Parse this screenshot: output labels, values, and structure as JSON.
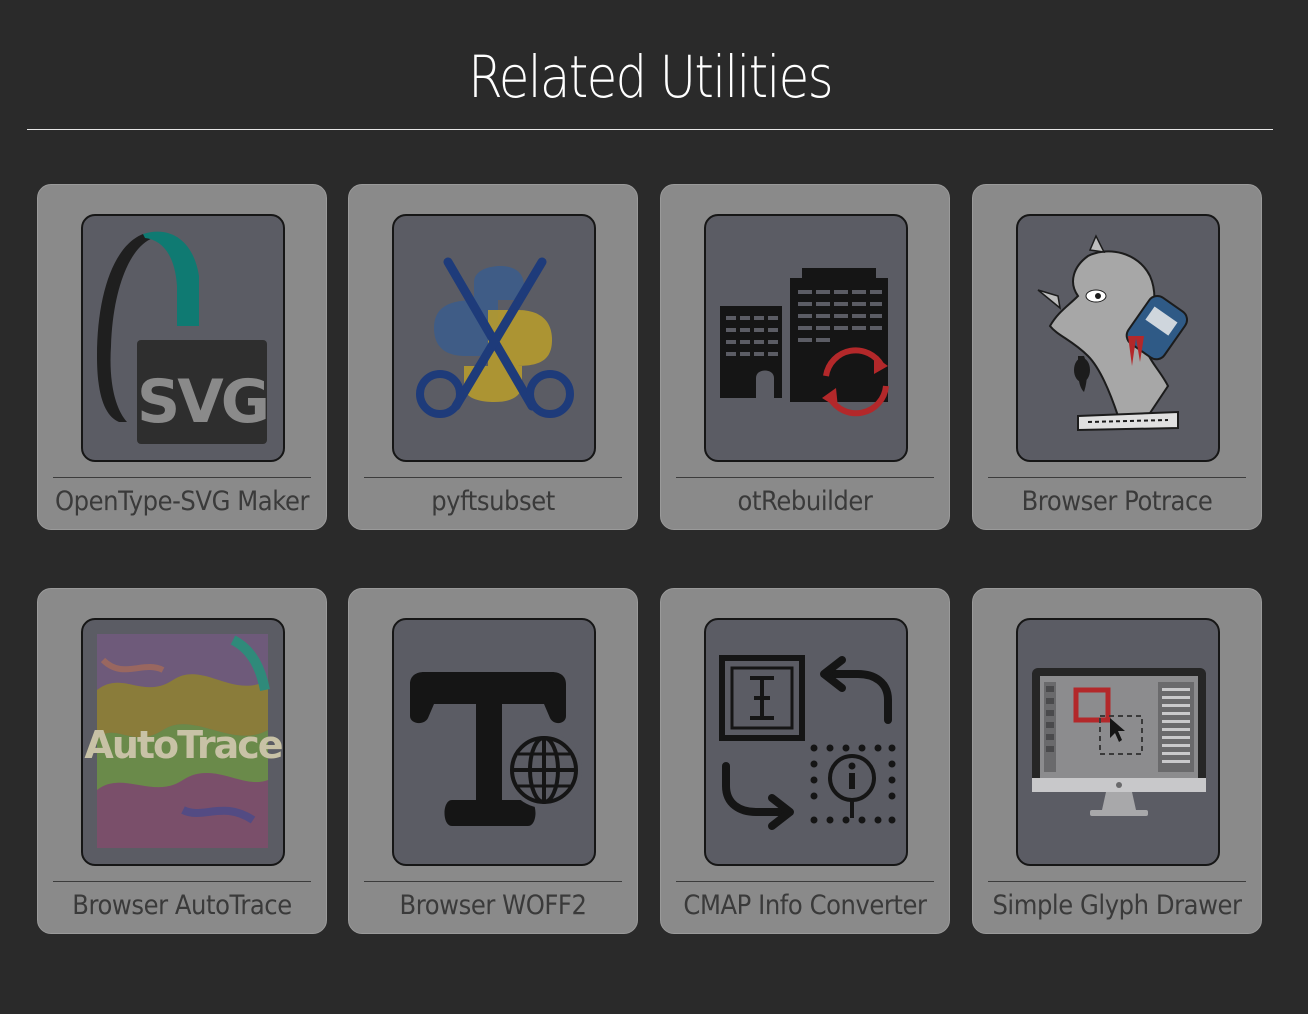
{
  "page": {
    "title": "Related Utilities"
  },
  "utilities": [
    {
      "label": "OpenType-SVG Maker",
      "icon": "svg-logo-icon"
    },
    {
      "label": "pyftsubset",
      "icon": "python-scissors-icon"
    },
    {
      "label": "otRebuilder",
      "icon": "buildings-rebuild-icon"
    },
    {
      "label": "Browser Potrace",
      "icon": "potrace-bird-icon"
    },
    {
      "label": "Browser AutoTrace",
      "icon": "autotrace-marble-icon"
    },
    {
      "label": "Browser WOFF2",
      "icon": "type-globe-icon"
    },
    {
      "label": "CMAP Info Converter",
      "icon": "cmap-convert-icon"
    },
    {
      "label": "Simple Glyph Drawer",
      "icon": "monitor-drawing-icon"
    }
  ],
  "colors": {
    "background": "#2a2a2a",
    "card": "#8a8a8a",
    "thumb": "#5b5c64",
    "label": "#3a3a3a",
    "svg_teal": "#0f7a72",
    "rebuild_red": "#b3282a",
    "python_blue": "#1e3b7a",
    "python_yellow": "#c9a526"
  }
}
